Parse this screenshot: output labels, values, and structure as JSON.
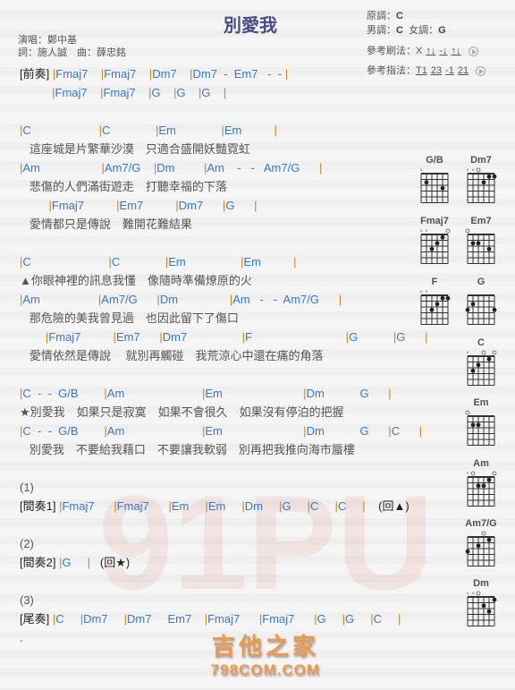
{
  "header": {
    "title": "別愛我",
    "singer": "演唱：鄭中基",
    "credits": "詞：施人誠　曲：薛忠銘",
    "original_key_label": "原調：",
    "original_key": "C",
    "male_key_label": "男調：",
    "male_key": "C",
    "female_key_label": "女調：",
    "female_key": "G",
    "strum_label": "參考刷法：",
    "strum": [
      "X",
      "↑↓",
      "-↓",
      "↑↓"
    ],
    "finger_label": "參考指法：",
    "finger": [
      "T1",
      "23",
      "-1",
      "21"
    ]
  },
  "rows": [
    {
      "label": "[前奏]",
      "chords": "|Fmaj7    |Fmaj7    |Dm7    |Dm7  -  Em7   -  - |"
    },
    {
      "chords": "          |Fmaj7    |Fmaj7    |G    |G    |G    |"
    },
    {},
    {
      "chords": "|C                     |C              |Em              |Em          |"
    },
    {
      "lyric": "   這座城是片繁華沙漠　只適合盛開妖豔霓虹"
    },
    {
      "chords": "|Am                   |Am7/G    |Dm         |Am    -   -   Am7/G      |"
    },
    {
      "lyric": "   悲傷的人們滿街遊走　打聽幸福的下落"
    },
    {
      "chords": "         |Fmaj7          |Em7          |Dm7      |G      |"
    },
    {
      "lyric": "   愛情都只是傳說　難開花難結果"
    },
    {},
    {
      "chords": "|C                        |C              |Em                 |Em          |"
    },
    {
      "lyric": "▲你眼神裡的訊息我懂　像隨時準備燎原的火"
    },
    {
      "chords": "|Am                  |Am7/G      |Dm                |Am   -   -  Am7/G      |"
    },
    {
      "lyric": "   那危險的美我曾見過　也因此留下了傷口"
    },
    {
      "chords": "        |Fmaj7          |Em7      |Dm7                 |F                             |G           |G      |"
    },
    {
      "lyric": "   愛情依然是傳說　 就別再觸碰　我荒涼心中還在痛的角落"
    },
    {},
    {
      "chords": "|C  -  -  G/B        |Am                        |Em                         |Dm           G      |"
    },
    {
      "lyric": "★別愛我　如果只是寂寞　如果不會很久　如果沒有停泊的把握"
    },
    {
      "chords": "|C  -  -  G/B        |Am                        |Em                         |Dm           G      |C      |"
    },
    {
      "lyric": "   別愛我　不要給我藉口　不要讓我軟弱　別再把我推向海市蜃樓"
    },
    {},
    {
      "lyric": "(1)"
    },
    {
      "label": "[間奏1]",
      "chords": "|Fmaj7      |Fmaj7      |Em     |Em     |Dm     |G     |C     |C     |    (回▲)"
    },
    {},
    {
      "lyric": "(2)"
    },
    {
      "label": "[間奏2]",
      "chords": "|G     |   (回★)"
    },
    {},
    {
      "lyric": "(3)"
    },
    {
      "label": "[尾奏]",
      "chords": "|C     |Dm7     |Dm7     Em7    |Fmaj7      |Fmaj7      |G     |G     |C     |"
    },
    {
      "lyric": "."
    }
  ],
  "chord_diagrams": [
    {
      "name": "G/B",
      "frets": [
        "x",
        2,
        "",
        "",
        3,
        ""
      ]
    },
    {
      "name": "Dm7",
      "frets": [
        "x",
        "x",
        "o",
        2,
        1,
        1
      ]
    },
    {
      "name": "Fmaj7",
      "frets": [
        "x",
        "x",
        3,
        2,
        1,
        "o"
      ]
    },
    {
      "name": "Em7",
      "frets": [
        "o",
        2,
        2,
        "",
        3,
        ""
      ]
    },
    {
      "name": "F",
      "frets": [
        "x",
        "x",
        3,
        2,
        1,
        1
      ]
    },
    {
      "name": "G",
      "frets": [
        3,
        2,
        "",
        "",
        "",
        3
      ]
    },
    {
      "name": "C",
      "frets": [
        "x",
        3,
        2,
        "o",
        1,
        "o"
      ]
    },
    {
      "name": "Em",
      "frets": [
        "o",
        2,
        2,
        "",
        "",
        ""
      ]
    },
    {
      "name": "Am",
      "frets": [
        "x",
        "o",
        2,
        2,
        1,
        "o"
      ]
    },
    {
      "name": "Am7/G",
      "frets": [
        3,
        "",
        2,
        "o",
        1,
        ""
      ]
    },
    {
      "name": "Dm",
      "frets": [
        "x",
        "x",
        "o",
        2,
        3,
        1
      ]
    }
  ],
  "watermark": {
    "text": "91PU"
  },
  "logo": {
    "line1": "吉他之家",
    "line2": "798COM.COM"
  },
  "colors": {
    "bar": "#c8861a",
    "chord": "#3a78c4",
    "title": "#4a4a86",
    "logo": "#ec9a50"
  }
}
